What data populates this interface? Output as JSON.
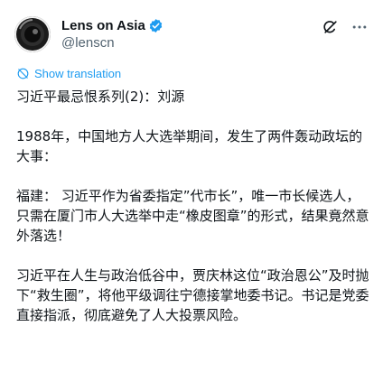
{
  "author": {
    "display_name": "Lens on Asia",
    "handle": "@lenscn",
    "verified_color": "#1d9bf0"
  },
  "actions": {
    "grok_icon": "grok-icon",
    "more_icon": "more-icon"
  },
  "translate": {
    "label": "Show translation",
    "icon": "globe-icon",
    "color": "#1d9bf0"
  },
  "post": {
    "paragraphs": [
      "习近平最忌恨系列(2)：刘源",
      "1988年，中国地方人大选举期间，发生了两件轰动政坛的大事：",
      "福建： 习近平作为省委指定”代市长”，唯一市长候选人，只需在厦门市人大选举中走“橡皮图章”的形式，结果竟然意外落选！",
      "习近平在人生与政治低谷中，贾庆林这位“政治恩公”及时抛下“救生圈”，将他平级调往宁德接掌地委书记。书记是党委直接指派，彻底避免了人大投票风险。"
    ]
  }
}
